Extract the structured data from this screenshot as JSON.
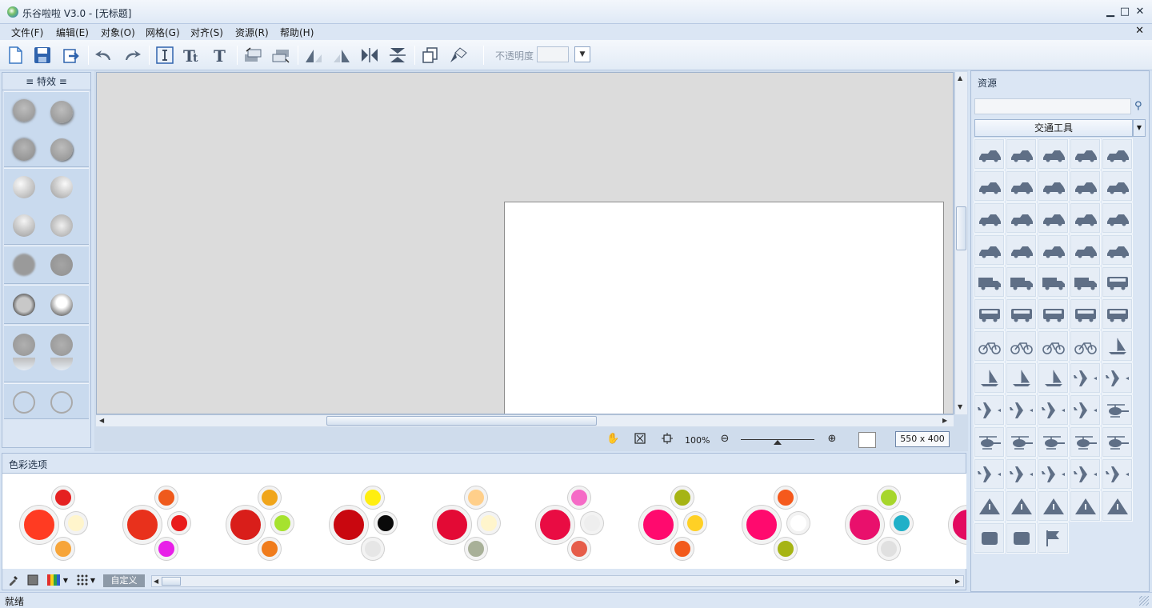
{
  "window": {
    "title": "乐谷啦啦 V3.0 - [无标题]",
    "minimize": "▁",
    "maximize": "□",
    "close": "✕"
  },
  "menu": [
    {
      "label": "文件(F)"
    },
    {
      "label": "编辑(E)"
    },
    {
      "label": "对象(O)"
    },
    {
      "label": "网格(G)"
    },
    {
      "label": "对齐(S)"
    },
    {
      "label": "资源(R)"
    },
    {
      "label": "帮助(H)"
    }
  ],
  "menu_close": "✕",
  "toolbar": {
    "buttons": [
      "new-file-icon",
      "save-icon",
      "export-icon",
      "undo-icon",
      "redo-icon",
      "text-frame-icon",
      "text-size-icon",
      "text-style-icon",
      "bring-forward-icon",
      "send-backward-icon",
      "flip-left-icon",
      "flip-right-icon",
      "mirror-horizontal-icon",
      "mirror-vertical-icon",
      "copy-icon",
      "paint-brush-icon"
    ],
    "opacity_label": "不透明度",
    "opacity_value": ""
  },
  "effects_panel": {
    "title": "≡ 特效 ≡"
  },
  "canvas": {
    "zoom": "100%",
    "size_label": "550 x 400",
    "zoom_level": 0.5
  },
  "color_panel": {
    "title": "色彩选项",
    "custom_button": "自定义",
    "palettes": [
      {
        "big": "#ff3b22",
        "s1": "#e52121",
        "s2": "#fff5cc",
        "s3": "#f7a53a"
      },
      {
        "big": "#e8311c",
        "s1": "#ef5a1c",
        "s2": "#e91c1c",
        "s3": "#e81fe8"
      },
      {
        "big": "#d91e1a",
        "s1": "#f0a51a",
        "s2": "#a6e22e",
        "s3": "#f07c1c"
      },
      {
        "big": "#c9070f",
        "s1": "#ffee10",
        "s2": "#0a0a0a",
        "s3": "#e6e6e6"
      },
      {
        "big": "#e30a35",
        "s1": "#ffcf8a",
        "s2": "#fff5cc",
        "s3": "#a8b098"
      },
      {
        "big": "#e90c43",
        "s1": "#f56bc6",
        "s2": "#eeeeee",
        "s3": "#e65d4a"
      },
      {
        "big": "#ff0a6e",
        "s1": "#a6b414",
        "s2": "#ffd025",
        "s3": "#f25a1c"
      },
      {
        "big": "#ff0a6e",
        "s1": "#f5591c",
        "s2": "#ffffff",
        "s3": "#a6b414"
      },
      {
        "big": "#e9106c",
        "s1": "#a6d62b",
        "s2": "#20b0c8",
        "s3": "#e0e0e0"
      },
      {
        "big": "#e30a60",
        "s1": "#f56bc6",
        "s2": "#eeeeee",
        "s3": "#e65d4a"
      }
    ]
  },
  "resources": {
    "title": "资源",
    "search_placeholder": "",
    "category": "交通工具",
    "items": [
      "sedan",
      "hatchback",
      "suv-front",
      "pickup",
      "race-car",
      "limousine",
      "coupe",
      "car-outline",
      "car-front",
      "car-front-2",
      "jeep",
      "van",
      "wagon",
      "pickup-2",
      "truck",
      "box-truck",
      "army-truck",
      "small-truck",
      "camper",
      "lorry",
      "trailer-truck",
      "wheel-loader",
      "tractor",
      "delivery-truck",
      "bus-front",
      "coach-bus",
      "minibus",
      "bus",
      "steam-train",
      "horse-carriage",
      "cargo-container",
      "motorcycle",
      "bicycle",
      "bicycle-2",
      "sail",
      "sailboat",
      "yacht",
      "ship",
      "windsurf",
      "airplane",
      "jet",
      "rocket",
      "fighter-jet",
      "airliner",
      "helicopter",
      "small-plane",
      "helicopter-2",
      "chopper",
      "military-helicopter",
      "gunship",
      "seaplane",
      "glider",
      "propeller-plane",
      "horse-rider",
      "pyramid-tent",
      "warning-sign",
      "slippery-road-sign",
      "crossing-sign",
      "tunnel",
      "ufo",
      "sign-post",
      "biplane",
      "flag"
    ]
  },
  "status": {
    "text": "就绪"
  }
}
